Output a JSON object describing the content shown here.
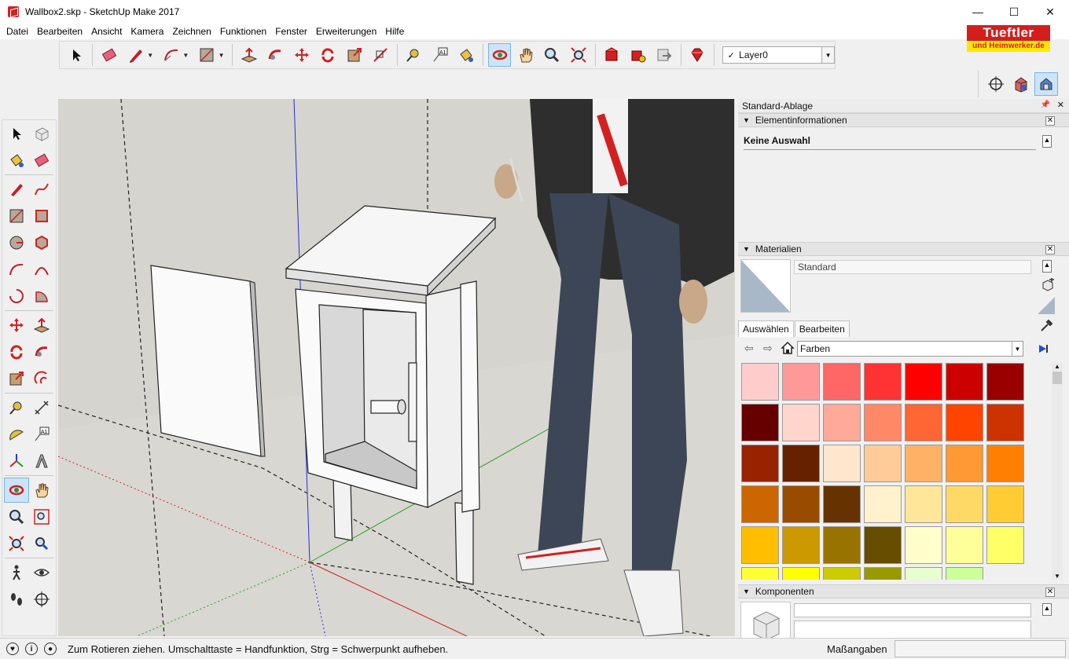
{
  "window": {
    "title": "Wallbox2.skp - SketchUp Make 2017",
    "minimize": "—",
    "maximize": "☐",
    "close": "✕"
  },
  "menu": [
    "Datei",
    "Bearbeiten",
    "Ansicht",
    "Kamera",
    "Zeichnen",
    "Funktionen",
    "Fenster",
    "Erweiterungen",
    "Hilfe"
  ],
  "logo": {
    "top": "Tueftler",
    "bottom": "und Heimwerker.de"
  },
  "toolbar": {
    "layer_value": "Layer0",
    "layer_check": "✓"
  },
  "tray": {
    "title": "Standard-Ablage",
    "entity_info": {
      "header": "Elementinformationen",
      "selection": "Keine Auswahl"
    },
    "materials": {
      "header": "Materialien",
      "current_name": "Standard",
      "tabs": [
        "Auswählen",
        "Bearbeiten"
      ],
      "library": "Farben",
      "swatches": [
        "#ffcccc",
        "#ff9999",
        "#ff6666",
        "#ff3333",
        "#ff0000",
        "#cc0000",
        "#990000",
        "#660000",
        "#ffd5cc",
        "#ffaa99",
        "#ff8866",
        "#ff6633",
        "#ff4400",
        "#cc3300",
        "#992200",
        "#662200",
        "#ffe6cc",
        "#ffcc99",
        "#ffb266",
        "#ff9933",
        "#ff8000",
        "#cc6600",
        "#994c00",
        "#663300",
        "#fff2cc",
        "#ffe699",
        "#ffd966",
        "#ffcc33",
        "#ffbf00",
        "#cc9900",
        "#997300",
        "#664d00",
        "#ffffcc",
        "#ffff99",
        "#ffff66",
        "#ffff33",
        "#ffff00",
        "#cccc00",
        "#999900",
        "#e6ffcc",
        "#ccff99"
      ]
    },
    "components": {
      "header": "Komponenten"
    }
  },
  "status": {
    "message": "Zum Rotieren ziehen. Umschalttaste = Handfunktion, Strg = Schwerpunkt aufheben.",
    "measure_label": "Maßangaben",
    "measure_value": ""
  },
  "colors": {
    "accent": "#cce4f7",
    "viewport_bg": "#d9d7d2",
    "logo_red": "#d41e1e",
    "logo_yellow": "#ffe800"
  }
}
